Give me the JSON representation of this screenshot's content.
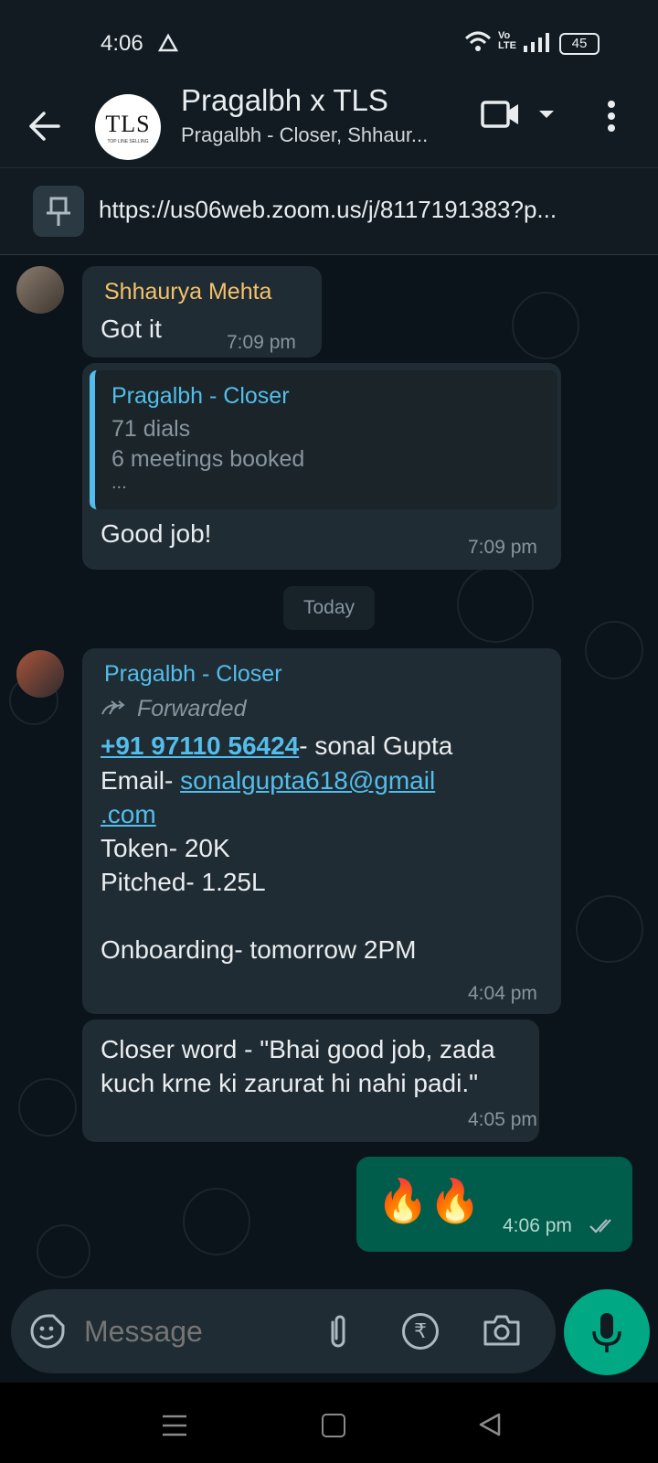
{
  "status_bar": {
    "time": "4:06",
    "battery": "45",
    "network": "Vo LTE"
  },
  "header": {
    "avatar_text": "TLS",
    "avatar_subtext": "TOP LINE SELLING",
    "title": "Pragalbh x TLS",
    "subtitle": "Pragalbh - Closer, Shhaur..."
  },
  "pinned": {
    "text": "https://us06web.zoom.us/j/8117191383?p..."
  },
  "messages": {
    "m1": {
      "sender": "Shhaurya Mehta",
      "text": "Got it",
      "time": "7:09 pm"
    },
    "m2": {
      "quote_sender": "Pragalbh - Closer",
      "quote_line1": "71 dials",
      "quote_line2": "6 meetings booked",
      "quote_line3": "...",
      "text": "Good job!",
      "time": "7:09 pm"
    },
    "day_divider": "Today",
    "m3": {
      "sender": "Pragalbh - Closer",
      "forwarded": "Forwarded",
      "phone": "+91 97110 56424",
      "phone_suffix": "- sonal Gupta",
      "email_label": "Email- ",
      "email_part1": "sonalgupta618@gmail",
      "email_part2": ".com",
      "line_token": "Token- 20K",
      "line_pitched": "Pitched- 1.25L",
      "line_onboarding": "Onboarding- tomorrow 2PM",
      "time": "4:04 pm"
    },
    "m4": {
      "line1": "Closer word - \"Bhai good job, zada",
      "line2": "kuch krne ki zarurat hi nahi padi.\"",
      "time": "4:05 pm"
    },
    "m5": {
      "emoji": "🔥🔥",
      "time": "4:06 pm"
    }
  },
  "input": {
    "placeholder": "Message"
  },
  "colors": {
    "accent": "#00a884",
    "outgoing": "#005c4b",
    "incoming": "#202c33",
    "sender1": "#f5c26b",
    "sender2": "#53bdeb"
  }
}
